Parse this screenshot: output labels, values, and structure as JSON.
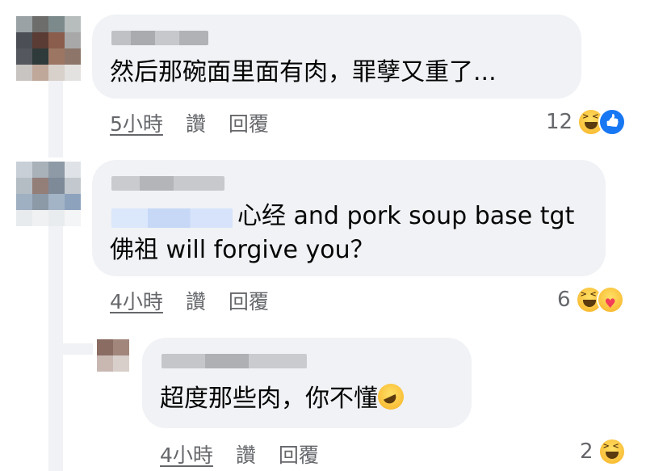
{
  "comments": [
    {
      "text_lines": [
        "然后那碗面里面有肉，罪孽又重了..."
      ],
      "time": "5小時",
      "like_label": "讚",
      "reply_label": "回覆",
      "reaction_count": "12",
      "reactions": [
        "haha-icon",
        "like-icon"
      ]
    },
    {
      "text_lines": [
        "心经 and pork soup base tgt",
        "佛祖 will forgive you？"
      ],
      "time": "4小時",
      "like_label": "讚",
      "reply_label": "回覆",
      "reaction_count": "6",
      "reactions": [
        "haha-icon",
        "care-icon"
      ]
    }
  ],
  "reply": {
    "text": "超度那些肉，你不懂",
    "emoji": "rolling-laughing-emoji",
    "time": "4小時",
    "like_label": "讚",
    "reply_label": "回覆",
    "reaction_count": "2",
    "reactions": [
      "haha-icon"
    ]
  },
  "colors": {
    "bubble": "#f0f2f5",
    "meta_text": "#65676b",
    "like_blue": "#1877f2"
  }
}
